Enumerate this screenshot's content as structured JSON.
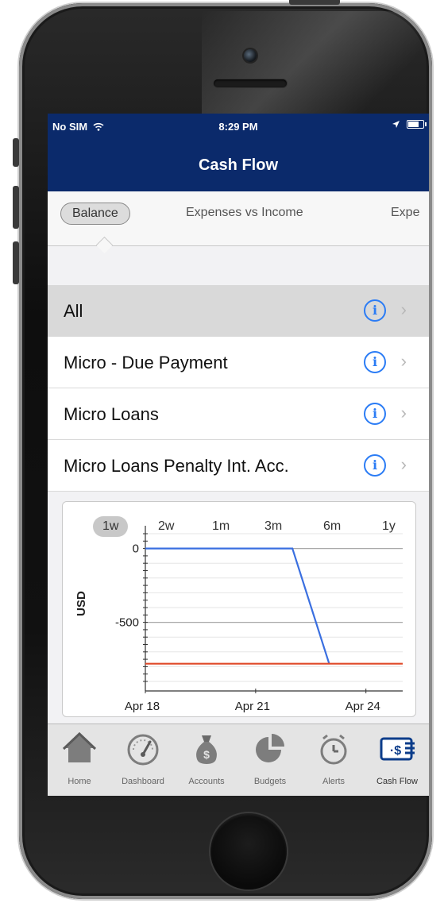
{
  "status_bar": {
    "carrier": "No SIM",
    "time": "8:29 PM"
  },
  "nav": {
    "title": "Cash Flow"
  },
  "segments": [
    {
      "label": "Balance",
      "active": true
    },
    {
      "label": "Expenses vs Income",
      "active": false
    },
    {
      "label": "Expe",
      "active": false
    }
  ],
  "accounts": [
    {
      "label": "All",
      "selected": true
    },
    {
      "label": "Micro - Due Payment",
      "selected": false
    },
    {
      "label": "Micro Loans",
      "selected": false
    },
    {
      "label": "Micro Loans Penalty Int. Acc.",
      "selected": false
    }
  ],
  "icons": {
    "info": "i",
    "chevron": "›"
  },
  "chart": {
    "ranges": [
      "1w",
      "2w",
      "1m",
      "3m",
      "6m",
      "1y"
    ],
    "selected_range": "1w"
  },
  "chart_data": {
    "type": "line",
    "ylabel": "USD",
    "xlabel": "",
    "x_ticks": [
      "Apr 18",
      "Apr 21",
      "Apr 24"
    ],
    "y_ticks": [
      0,
      -500
    ],
    "ylim": [
      -900,
      100
    ],
    "series": [
      {
        "color": "#3a6fe0",
        "x": [
          "Apr 18",
          "Apr 22",
          "Apr 23",
          "Apr 24"
        ],
        "y": [
          0,
          0,
          -780,
          -780
        ],
        "points": [
          [
            0,
            0
          ],
          [
            4,
            0
          ],
          [
            5,
            -780
          ]
        ]
      },
      {
        "color": "#e04a2a",
        "y_const": -780,
        "points": [
          [
            0,
            -780
          ],
          [
            7,
            -780
          ]
        ]
      }
    ],
    "x_span_days": 7
  },
  "tab_bar": [
    {
      "label": "Home",
      "icon": "home-icon"
    },
    {
      "label": "Dashboard",
      "icon": "speedometer-icon"
    },
    {
      "label": "Accounts",
      "icon": "money-bag-icon"
    },
    {
      "label": "Budgets",
      "icon": "pie-chart-icon"
    },
    {
      "label": "Alerts",
      "icon": "stopwatch-icon"
    },
    {
      "label": "Cash Flow",
      "icon": "cash-flow-icon",
      "active": true
    }
  ],
  "colors": {
    "navbar": "#0b2a6b",
    "accent_blue": "#2b7cf5",
    "series_blue": "#3a6fe0",
    "series_red": "#e04a2a"
  }
}
